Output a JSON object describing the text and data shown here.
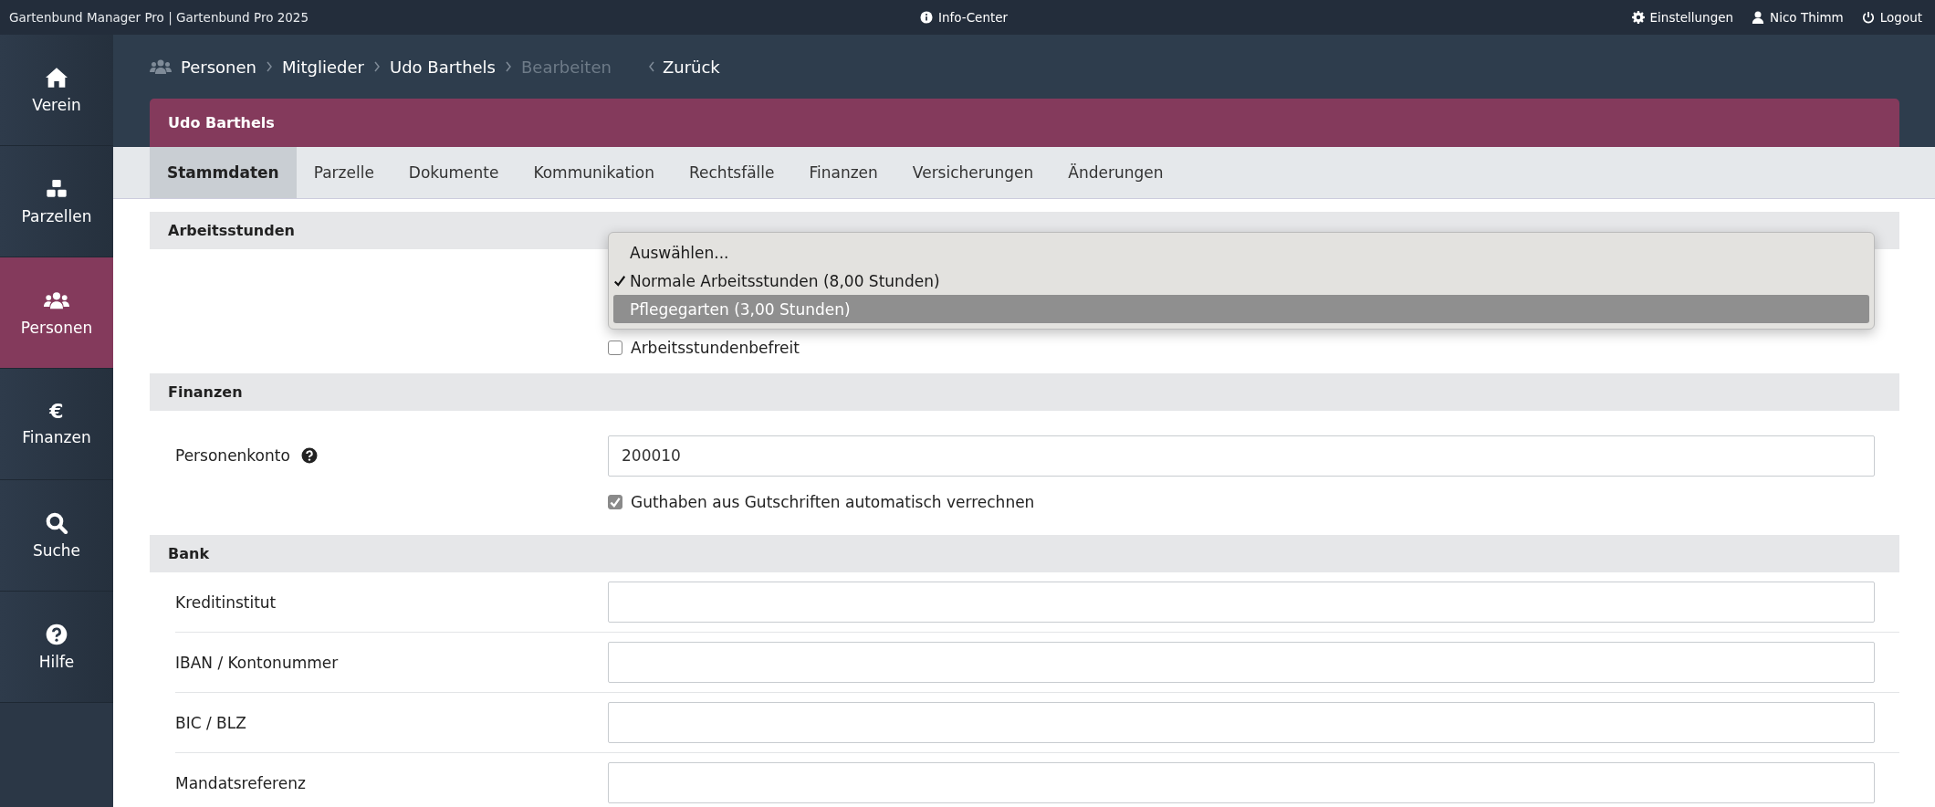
{
  "top_bar": {
    "app_title": "Gartenbund Manager Pro | Gartenbund Pro 2025",
    "info_center": "Info-Center",
    "settings": "Einstellungen",
    "user": "Nico Thimm",
    "logout": "Logout"
  },
  "sidebar": {
    "items": [
      {
        "label": "Verein",
        "selected": false
      },
      {
        "label": "Parzellen",
        "selected": false
      },
      {
        "label": "Personen",
        "selected": true
      },
      {
        "label": "Finanzen",
        "selected": false,
        "glyph": "€"
      },
      {
        "label": "Suche",
        "selected": false
      },
      {
        "label": "Hilfe",
        "selected": false
      }
    ]
  },
  "breadcrumb": {
    "items": [
      {
        "label": "Personen",
        "current": false
      },
      {
        "label": "Mitglieder",
        "current": false
      },
      {
        "label": "Udo Barthels",
        "current": false
      },
      {
        "label": "Bearbeiten",
        "current": true
      }
    ],
    "back": "Zurück"
  },
  "header": {
    "title": "Udo Barthels"
  },
  "tabs": [
    {
      "label": "Stammdaten",
      "selected": true
    },
    {
      "label": "Parzelle",
      "selected": false
    },
    {
      "label": "Dokumente",
      "selected": false
    },
    {
      "label": "Kommunikation",
      "selected": false
    },
    {
      "label": "Rechtsfälle",
      "selected": false
    },
    {
      "label": "Finanzen",
      "selected": false
    },
    {
      "label": "Versicherungen",
      "selected": false
    },
    {
      "label": "Änderungen",
      "selected": false
    }
  ],
  "arbeitsstunden": {
    "title": "Arbeitsstunden",
    "dropdown": [
      {
        "label": "Auswählen...",
        "selected": false,
        "highlighted": false
      },
      {
        "label": "Normale Arbeitsstunden (8,00 Stunden)",
        "selected": true,
        "highlighted": false
      },
      {
        "label": "Pflegegarten (3,00 Stunden)",
        "selected": false,
        "highlighted": true
      }
    ],
    "exempt": {
      "label": "Arbeitsstundenbefreit",
      "checked": false
    }
  },
  "finanzen": {
    "title": "Finanzen",
    "account_label": "Personenkonto",
    "account_value": "200010",
    "offset": {
      "label": "Guthaben aus Gutschriften automatisch verrechnen",
      "checked": true
    }
  },
  "bank": {
    "title": "Bank",
    "fields": [
      {
        "label": "Kreditinstitut"
      },
      {
        "label": "IBAN / Kontonummer"
      },
      {
        "label": "BIC / BLZ"
      },
      {
        "label": "Mandatsreferenz"
      }
    ]
  }
}
